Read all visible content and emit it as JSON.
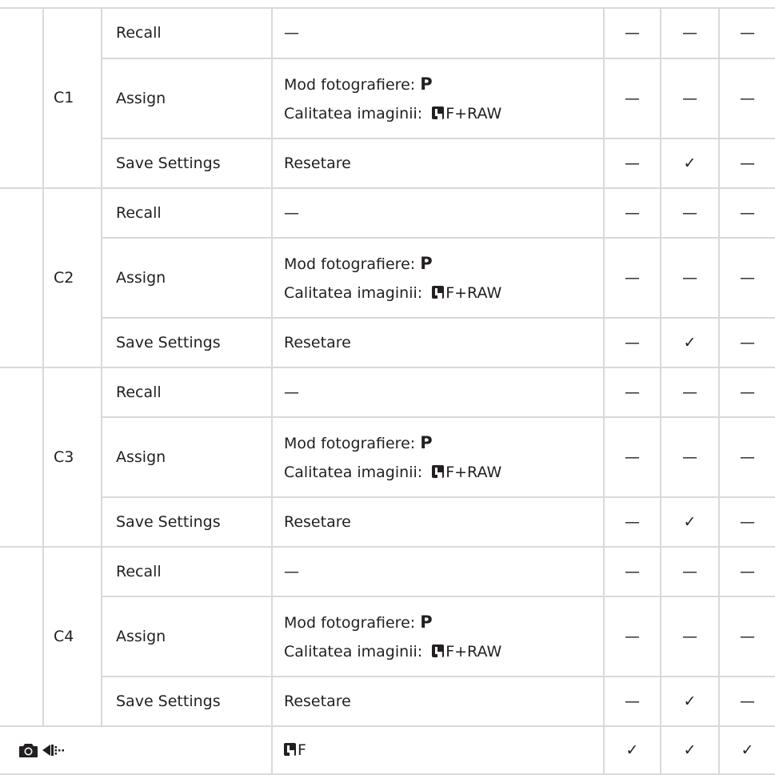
{
  "groups": [
    {
      "label": "C1",
      "rows": [
        {
          "action": "Recall",
          "value_text": "—",
          "checks": [
            "—",
            "—",
            "—"
          ]
        },
        {
          "action": "Assign",
          "value_line1": "Mod fotografiere: ",
          "value_line1_bold": "P",
          "value_line2": "Calitatea imaginii: ",
          "value_line2_suffix": "F+RAW",
          "checks": [
            "—",
            "—",
            "—"
          ]
        },
        {
          "action": "Save Settings",
          "value_text": "Resetare",
          "checks": [
            "—",
            "✓",
            "—"
          ]
        }
      ]
    },
    {
      "label": "C2",
      "rows": [
        {
          "action": "Recall",
          "value_text": "—",
          "checks": [
            "—",
            "—",
            "—"
          ]
        },
        {
          "action": "Assign",
          "value_line1": "Mod fotografiere: ",
          "value_line1_bold": "P",
          "value_line2": "Calitatea imaginii: ",
          "value_line2_suffix": "F+RAW",
          "checks": [
            "—",
            "—",
            "—"
          ]
        },
        {
          "action": "Save Settings",
          "value_text": "Resetare",
          "checks": [
            "—",
            "✓",
            "—"
          ]
        }
      ]
    },
    {
      "label": "C3",
      "rows": [
        {
          "action": "Recall",
          "value_text": "—",
          "checks": [
            "—",
            "—",
            "—"
          ]
        },
        {
          "action": "Assign",
          "value_line1": "Mod fotografiere: ",
          "value_line1_bold": "P",
          "value_line2": "Calitatea imaginii: ",
          "value_line2_suffix": "F+RAW",
          "checks": [
            "—",
            "—",
            "—"
          ]
        },
        {
          "action": "Save Settings",
          "value_text": "Resetare",
          "checks": [
            "—",
            "✓",
            "—"
          ]
        }
      ]
    },
    {
      "label": "C4",
      "rows": [
        {
          "action": "Recall",
          "value_text": "—",
          "checks": [
            "—",
            "—",
            "—"
          ]
        },
        {
          "action": "Assign",
          "value_line1": "Mod fotografiere: ",
          "value_line1_bold": "P",
          "value_line2": "Calitatea imaginii: ",
          "value_line2_suffix": "F+RAW",
          "checks": [
            "—",
            "—",
            "—"
          ]
        },
        {
          "action": "Save Settings",
          "value_text": "Resetare",
          "checks": [
            "—",
            "✓",
            "—"
          ]
        }
      ]
    }
  ],
  "last_row": {
    "icons": [
      "camera-icon",
      "sequential-drive-icon"
    ],
    "value_suffix": "F",
    "checks": [
      "✓",
      "✓",
      "✓"
    ]
  }
}
